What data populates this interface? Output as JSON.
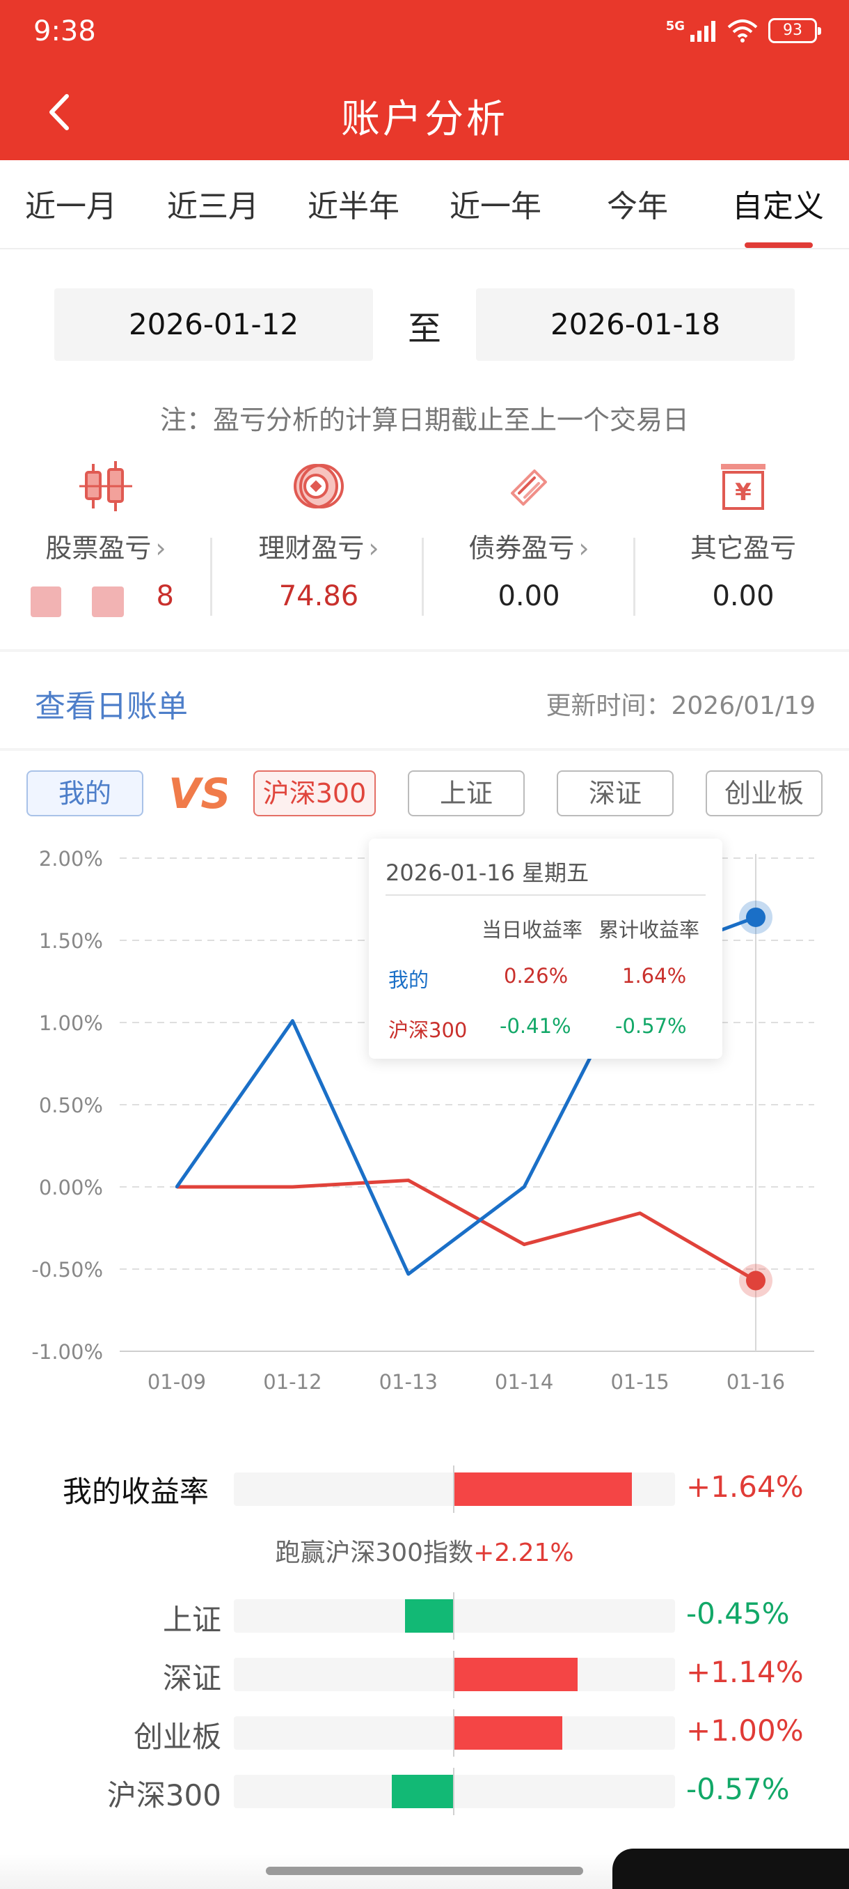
{
  "status": {
    "time": "9:38",
    "network": "5G",
    "battery": "93"
  },
  "header": {
    "title": "账户分析",
    "back_icon": "chevron-left-icon"
  },
  "tabs": [
    "近一月",
    "近三月",
    "近半年",
    "近一年",
    "今年",
    "自定义"
  ],
  "active_tab": "自定义",
  "date_range": {
    "start": "2026-01-12",
    "separator": "至",
    "end": "2026-01-18"
  },
  "note": "注：盈亏分析的计算日期截止至上一个交易日",
  "pl_items": [
    {
      "label": "股票盈亏",
      "value": "8",
      "icon": "candlestick-icon"
    },
    {
      "label": "理财盈亏",
      "value": "74.86",
      "icon": "coin-icon"
    },
    {
      "label": "债券盈亏",
      "value": "0.00",
      "icon": "bond-ticket-icon"
    },
    {
      "label": "其它盈亏",
      "value": "0.00",
      "icon": "yuan-box-icon"
    }
  ],
  "daily_bill_link": "查看日账单",
  "update_time": "更新时间：2026/01/19",
  "compare": {
    "mine": "我的",
    "vs": "VS",
    "buttons": [
      "沪深300",
      "上证",
      "深证",
      "创业板"
    ]
  },
  "tooltip": {
    "date": "2026-01-16 星期五",
    "col_daily": "当日收益率",
    "col_cum": "累计收益率",
    "rows": [
      {
        "name": "我的",
        "daily": "0.26%",
        "cum": "1.64%"
      },
      {
        "name": "沪深300",
        "daily": "-0.41%",
        "cum": "-0.57%"
      }
    ]
  },
  "chart_data": {
    "type": "line",
    "x": [
      "01-09",
      "01-12",
      "01-13",
      "01-14",
      "01-15",
      "01-16"
    ],
    "y_ticks": [
      "2.00%",
      "1.50%",
      "1.00%",
      "0.50%",
      "0.00%",
      "-0.50%",
      "-1.00%"
    ],
    "ylim": [
      -1.0,
      2.0
    ],
    "grid": true,
    "series": [
      {
        "name": "我的",
        "color": "#1a6fc7",
        "values": [
          0.0,
          1.01,
          -0.53,
          0.0,
          1.38,
          1.64
        ]
      },
      {
        "name": "沪深300",
        "color": "#e0423a",
        "values": [
          0.0,
          0.0,
          0.04,
          -0.35,
          -0.16,
          -0.57
        ]
      }
    ],
    "highlight_index": 5
  },
  "performance": {
    "title": "我的收益率",
    "mine": {
      "value": 1.64,
      "text": "+1.64%"
    },
    "outperform_prefix": "跑赢沪深300指数",
    "outperform_value": "+2.21%",
    "indices": [
      {
        "name": "上证",
        "value": -0.45,
        "text": "-0.45%"
      },
      {
        "name": "深证",
        "value": 1.14,
        "text": "+1.14%"
      },
      {
        "name": "创业板",
        "value": 1.0,
        "text": "+1.00%"
      },
      {
        "name": "沪深300",
        "value": -0.57,
        "text": "-0.57%"
      }
    ]
  }
}
